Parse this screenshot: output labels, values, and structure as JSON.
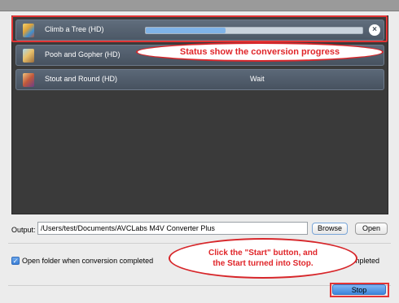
{
  "tasks": [
    {
      "title": "Climb a Tree (HD)",
      "progress": 0.37,
      "status": ""
    },
    {
      "title": "Pooh and Gopher (HD)",
      "status": ""
    },
    {
      "title": "Stout and Round (HD)",
      "status": "Wait"
    }
  ],
  "annotations": {
    "progress_callout": "Status show the conversion progress",
    "start_callout_line1": "Click the \"Start\" button, and",
    "start_callout_line2": "the Start turned into Stop."
  },
  "output": {
    "label": "Output:",
    "path": "/Users/test/Documents/AVCLabs M4V Converter Plus",
    "browse_label": "Browse",
    "open_label": "Open"
  },
  "options": {
    "open_folder_label": "Open folder when conversion completed",
    "open_folder_checked": true,
    "trailing_label": "mpleted"
  },
  "footer": {
    "stop_label": "Stop"
  },
  "colors": {
    "accent_red": "#e23535",
    "progress_fill": "#7fb3e8",
    "primary_button": "#3d86dc"
  }
}
